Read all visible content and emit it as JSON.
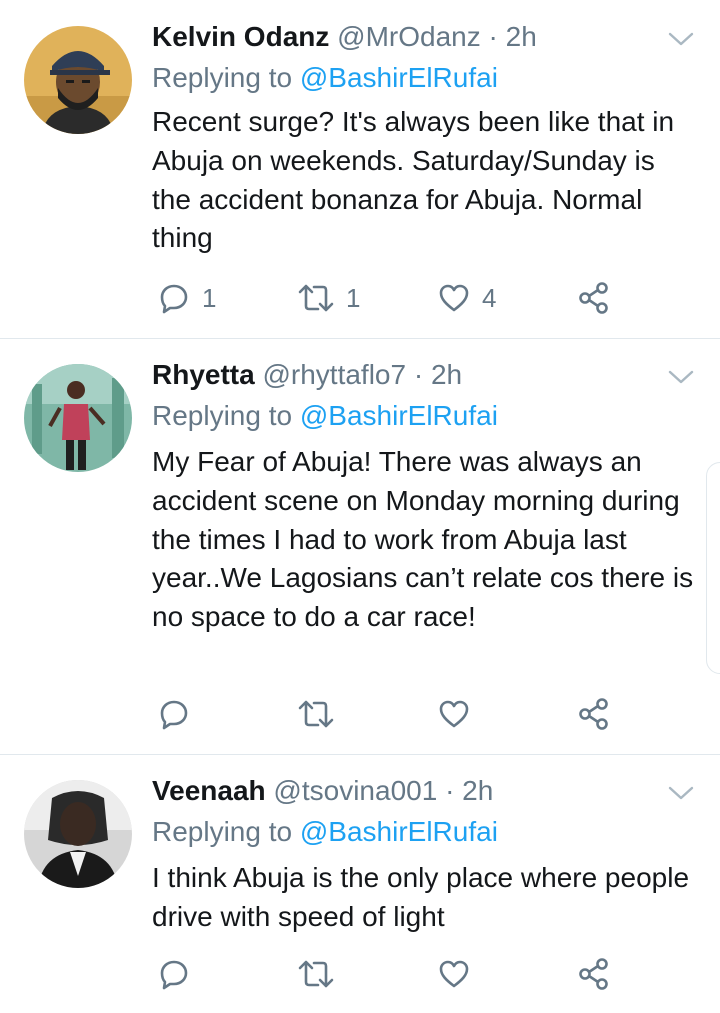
{
  "tweets": [
    {
      "name": "Kelvin Odanz",
      "handle": "@MrOdanz",
      "separator": "·",
      "time": "2h",
      "replying_prefix": "Replying to",
      "replying_to": "@BashirElRufai",
      "text": "Recent surge? It's always been like that in Abuja on weekends. Saturday/Sunday is the accident bonanza for Abuja. Normal thing",
      "replies": "1",
      "retweets": "1",
      "likes": "4",
      "avatar_bg": "#e0b25a"
    },
    {
      "name": "Rhyetta",
      "handle": "@rhyttaflo7",
      "separator": "·",
      "time": "2h",
      "replying_prefix": "Replying to",
      "replying_to": "@BashirElRufai",
      "text": "My Fear of Abuja! There was always an accident scene on Monday morning during the times I had to work from Abuja last year..We Lagosians can’t relate cos there is no space to do a car race!",
      "replies": "",
      "retweets": "",
      "likes": "",
      "avatar_bg": "#7fb7a7"
    },
    {
      "name": "Veenaah",
      "handle": "@tsovina001",
      "separator": "·",
      "time": "2h",
      "replying_prefix": "Replying to",
      "replying_to": "@BashirElRufai",
      "text": "I think Abuja is the only place where people drive with speed of light",
      "replies": "",
      "retweets": "",
      "likes": "",
      "avatar_bg": "#9a9a9a"
    }
  ],
  "colors": {
    "text": "#14171a",
    "secondary": "#657786",
    "accent": "#1da1f2",
    "divider": "#e1e8ed"
  },
  "icons": {
    "reply": "speech-bubble",
    "retweet": "retweet-arrows",
    "like": "heart-outline",
    "share": "share-nodes",
    "caret": "chevron-down"
  }
}
